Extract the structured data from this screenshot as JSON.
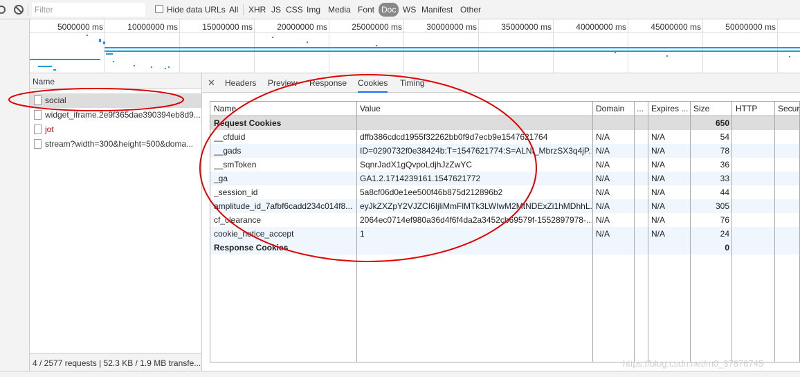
{
  "filter": {
    "placeholder": "Filter",
    "hide_data_urls": "Hide data URLs"
  },
  "types": [
    "All",
    "XHR",
    "JS",
    "CSS",
    "Img",
    "Media",
    "Font",
    "Doc",
    "WS",
    "Manifest",
    "Other"
  ],
  "active_type": "Doc",
  "timeline": {
    "ticks": [
      "5000000 ms",
      "10000000 ms",
      "15000000 ms",
      "20000000 ms",
      "25000000 ms",
      "30000000 ms",
      "35000000 ms",
      "40000000 ms",
      "45000000 ms",
      "50000000 ms"
    ]
  },
  "requests": {
    "column_name": "Name",
    "items": [
      {
        "name": "social"
      },
      {
        "name": "widget_iframe.2e9f365dae390394eb8d9..."
      },
      {
        "name": "jot"
      },
      {
        "name": "stream?width=300&height=500&doma..."
      }
    ],
    "footer": "4 / 2577 requests  |  52.3 KB / 1.9 MB transfe..."
  },
  "tabs": [
    "Headers",
    "Preview",
    "Response",
    "Cookies",
    "Timing"
  ],
  "active_tab": "Cookies",
  "cookies": {
    "columns": [
      "Name",
      "Value",
      "Domain",
      "...",
      "Expires ...",
      "Size",
      "HTTP",
      "Secure"
    ],
    "request_group": {
      "label": "Request Cookies",
      "size": "650"
    },
    "rows": [
      {
        "name": "__cfduid",
        "value": "dffb386cdcd1955f32262bb0f9d7ecb9e1547621764",
        "domain": "N/A",
        "path": "",
        "expires": "N/A",
        "size": "54"
      },
      {
        "name": "__gads",
        "value": "ID=0290732f0e38424b:T=1547621774:S=ALNI_MbrzSX3q4jP...",
        "domain": "N/A",
        "path": "",
        "expires": "N/A",
        "size": "78"
      },
      {
        "name": "__smToken",
        "value": "SqnrJadX1gQvpoLdjhJzZwYC",
        "domain": "N/A",
        "path": "",
        "expires": "N/A",
        "size": "36"
      },
      {
        "name": "_ga",
        "value": "GA1.2.1714239161.1547621772",
        "domain": "N/A",
        "path": "",
        "expires": "N/A",
        "size": "33"
      },
      {
        "name": "_session_id",
        "value": "5a8cf06d0e1ee500f46b875d212896b2",
        "domain": "N/A",
        "path": "",
        "expires": "N/A",
        "size": "44"
      },
      {
        "name": "amplitude_id_7afbf6cadd234c014f8...",
        "value": "eyJkZXZpY2VJZCI6IjliMmFlMTk3LWIwM2MtNDExZi1hMDhhL...",
        "domain": "N/A",
        "path": "",
        "expires": "N/A",
        "size": "305"
      },
      {
        "name": "cf_clearance",
        "value": "2064ec0714ef980a36d4f6f4da2a3452cb69579f-1552897978-...",
        "domain": "N/A",
        "path": "",
        "expires": "N/A",
        "size": "76"
      },
      {
        "name": "cookie_notice_accept",
        "value": "1",
        "domain": "N/A",
        "path": "",
        "expires": "N/A",
        "size": "24"
      }
    ],
    "response_group": {
      "label": "Response Cookies",
      "size": "0"
    }
  },
  "watermark": "https://blog.csdn.net/m0_37876745",
  "colors": {
    "accent": "#1a73e8",
    "annotation": "#e00000",
    "bar": "#1a9ad6"
  }
}
